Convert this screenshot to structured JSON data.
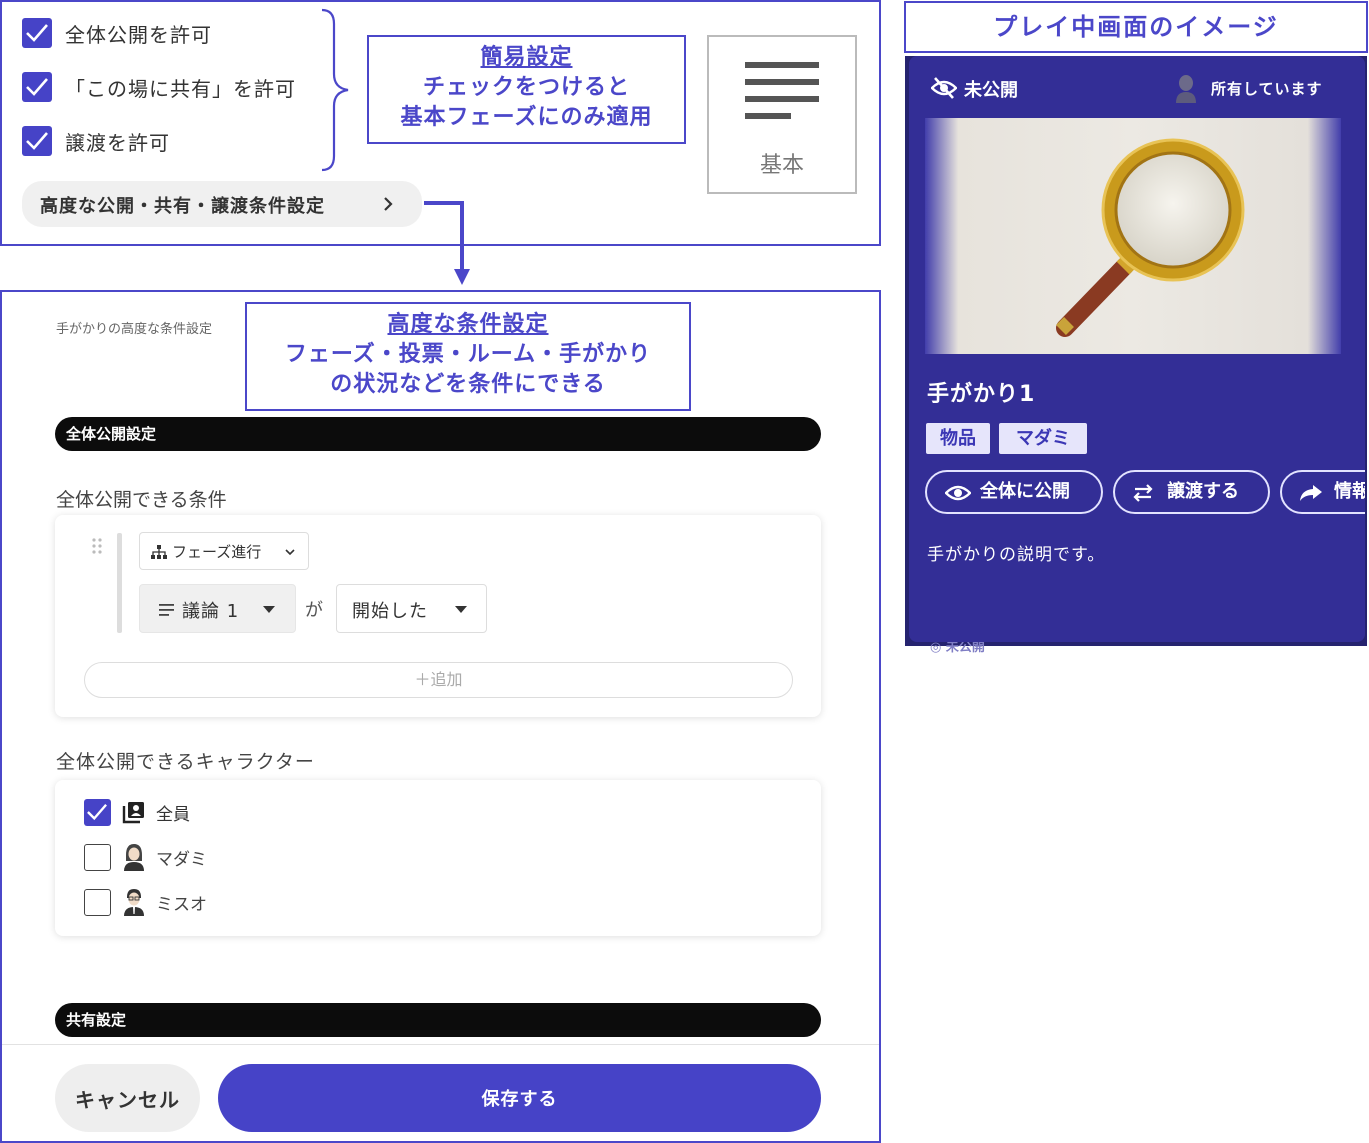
{
  "simple_settings": {
    "checks": [
      {
        "label": "全体公開を許可",
        "checked": true
      },
      {
        "label": "「この場に共有」を許可",
        "checked": true
      },
      {
        "label": "譲渡を許可",
        "checked": true
      }
    ],
    "advanced_button": "高度な公開・共有・譲渡条件設定",
    "callout": {
      "title": "簡易設定",
      "lines": [
        "チェックをつけると",
        "基本フェーズにのみ適用"
      ]
    },
    "basic_label": "基本"
  },
  "advanced": {
    "page_label": "手がかりの高度な条件設定",
    "callout": {
      "title": "高度な条件設定",
      "lines": [
        "フェーズ・投票・ルーム・手がかり",
        "の状況などを条件にできる"
      ]
    },
    "public_section": "全体公開設定",
    "conditions_title": "全体公開できる条件",
    "condition_type": "フェーズ進行",
    "condition_target": "議論 1",
    "condition_particle": "が",
    "condition_state": "開始した",
    "add_label": "追加",
    "characters_title": "全体公開できるキャラクター",
    "characters": [
      {
        "name": "全員",
        "checked": true
      },
      {
        "name": "マダミ",
        "checked": false
      },
      {
        "name": "ミスオ",
        "checked": false
      }
    ],
    "share_section": "共有設定",
    "cancel_label": "キャンセル",
    "save_label": "保存する"
  },
  "preview": {
    "title": "プレイ中画面のイメージ",
    "status": "未公開",
    "owned": "所有しています",
    "clue_name": "手がかり1",
    "tags": [
      "物品",
      "マダミ"
    ],
    "buttons": [
      "全体に公開",
      "譲渡する",
      "情報"
    ],
    "description": "手がかりの説明です。",
    "hidden_status": "未公開"
  },
  "colors": {
    "accent": "#4643c7",
    "card_bg": "#332e96",
    "frame": "#4b47c9"
  }
}
